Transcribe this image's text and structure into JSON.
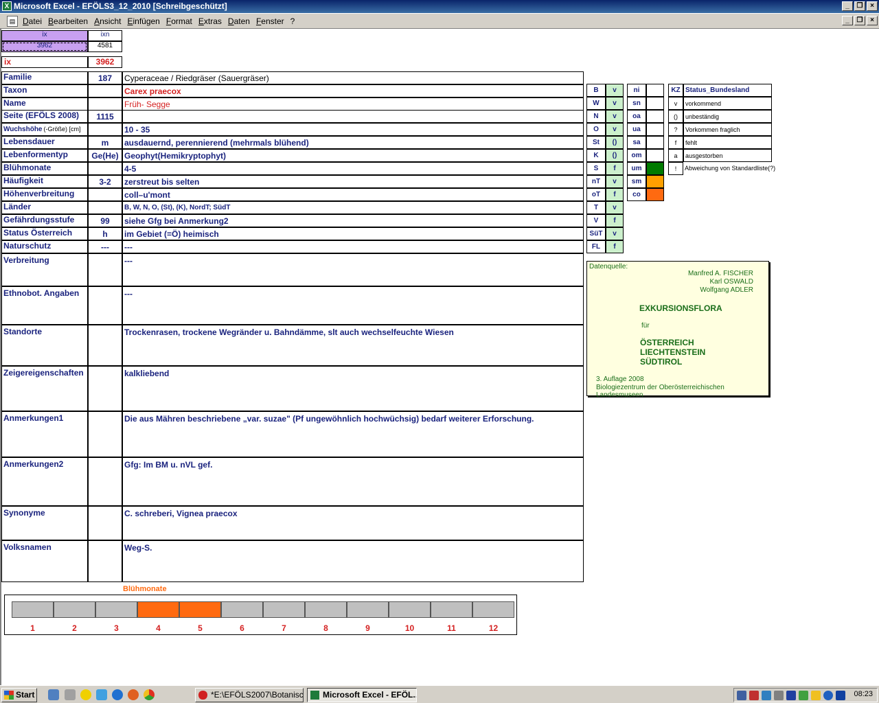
{
  "window": {
    "title": "Microsoft Excel - EFÖLS3_12_2010  [Schreibgeschützt]"
  },
  "menu": [
    "Datei",
    "Bearbeiten",
    "Ansicht",
    "Einfügen",
    "Format",
    "Extras",
    "Daten",
    "Fenster",
    "?"
  ],
  "topbox": {
    "ix_label": "ix",
    "ixn_label": "ixn",
    "ix_value": "3962",
    "ixn_value": "4581",
    "ix2_label": "ix",
    "ix2_value": "3962"
  },
  "rows": [
    {
      "label": "Familie",
      "code": "187",
      "value": "Cyperaceae  /  Riedgräser (Sauergräser)"
    },
    {
      "label": "Taxon",
      "code": "",
      "value": "Carex praecox"
    },
    {
      "label": "Name",
      "code": "",
      "value": "Früh- Segge"
    },
    {
      "label": "Seite (EFÖLS 2008)",
      "code": "1115",
      "value": ""
    },
    {
      "label": "Wuchshöhe",
      "label_suffix": "(-Größe) [cm]",
      "code": "",
      "value": "10 - 35"
    },
    {
      "label": "Lebensdauer",
      "code": "m",
      "value": "ausdauernd, perennierend (mehrmals blühend)"
    },
    {
      "label": "Lebenformentyp",
      "code": "Ge(He)",
      "value": "Geophyt(Hemikryptophyt)"
    },
    {
      "label": "Blühmonate",
      "code": "",
      "value": "4-5"
    },
    {
      "label": "Häufigkeit",
      "code": "3-2",
      "value": "zerstreut bis selten"
    },
    {
      "label": "Höhenverbreitung",
      "code": "",
      "value": "coll–u'mont"
    },
    {
      "label": "Länder",
      "code": "",
      "value": "B, W, N, O, (St), (K), NordT; SüdT"
    },
    {
      "label": "Gefährdungsstufe",
      "code": "99",
      "value": "siehe Gfg bei Anmerkung2"
    },
    {
      "label": "Status Österreich",
      "code": "h",
      "value": "im Gebiet (=Ö) heimisch"
    },
    {
      "label": "Naturschutz",
      "code": "---",
      "value": "---"
    }
  ],
  "tallrows": [
    {
      "label": "Verbreitung",
      "value": "---"
    },
    {
      "label": "Ethnobot. Angaben",
      "value": "---"
    },
    {
      "label": "Standorte",
      "value": "Trockenrasen, trockene Wegränder u. Bahndämme, slt auch wechselfeuchte Wiesen"
    },
    {
      "label": "Zeigereigenschaften",
      "value": "kalkliebend"
    },
    {
      "label": "Anmerkungen1",
      "value": "Die aus Mähren beschriebene „var. suzae\" (Pf ungewöhnlich hochwüchsig) bedarf weiterer Erforschung."
    },
    {
      "label": "Anmerkungen2",
      "value": "Gfg:  Im BM u. nVL gef."
    },
    {
      "label": "Synonyme",
      "value": "C. schreberi, Vignea praecox"
    },
    {
      "label": "Volksnamen",
      "value": "Weg-S."
    }
  ],
  "laender": [
    {
      "k": "B",
      "v": "v"
    },
    {
      "k": "W",
      "v": "v"
    },
    {
      "k": "N",
      "v": "v"
    },
    {
      "k": "O",
      "v": "v"
    },
    {
      "k": "St",
      "v": "()"
    },
    {
      "k": "K",
      "v": "()"
    },
    {
      "k": "S",
      "v": "f"
    },
    {
      "k": "nT",
      "v": "v"
    },
    {
      "k": "oT",
      "v": "f"
    },
    {
      "k": "T",
      "v": "v"
    },
    {
      "k": "V",
      "v": "f"
    },
    {
      "k": "SüT",
      "v": "v"
    },
    {
      "k": "FL",
      "v": "f"
    }
  ],
  "hoehen": [
    "ni",
    "sn",
    "oa",
    "ua",
    "sa",
    "om",
    "um",
    "sm",
    "co"
  ],
  "hoehen_colors": {
    "um": "#007a00",
    "sm": "#ffa000",
    "co": "#ff6a10"
  },
  "legend": {
    "kz": "KZ",
    "title": "Status_Bundesland",
    "items": [
      {
        "k": "v",
        "v": "vorkommend"
      },
      {
        "k": "()",
        "v": "unbeständig"
      },
      {
        "k": "?",
        "v": "Vorkommen fraglich"
      },
      {
        "k": "f",
        "v": "fehlt"
      },
      {
        "k": "a",
        "v": "ausgestorben"
      },
      {
        "k": "!",
        "v": "Abweichung von Standardliste(?)"
      }
    ]
  },
  "datenquelle": {
    "label": "Datenquelle:",
    "authors": [
      "Manfred A. FISCHER",
      "Karl OSWALD",
      "Wolfgang ADLER"
    ],
    "title": "EXKURSIONSFLORA",
    "fuer": "für",
    "regions": [
      "ÖSTERREICH",
      "LIECHTENSTEIN",
      "SÜDTIROL"
    ],
    "edition": "3. Auflage 2008",
    "publisher": "Biologiezentrum der Oberösterreichischen Landesmuseen"
  },
  "bluehmonate": {
    "label": "Blühmonate",
    "months": [
      "1",
      "2",
      "3",
      "4",
      "5",
      "6",
      "7",
      "8",
      "9",
      "10",
      "11",
      "12"
    ],
    "active": [
      4,
      5
    ],
    "colors": {
      "on": "#ff6a10",
      "off": "#c0c0c0"
    }
  },
  "taskbar": {
    "start": "Start",
    "tasks": [
      "*E:\\EFÖLS2007\\Botanisc...",
      "Microsoft Excel - EFÖL..."
    ],
    "clock": "08:23"
  }
}
